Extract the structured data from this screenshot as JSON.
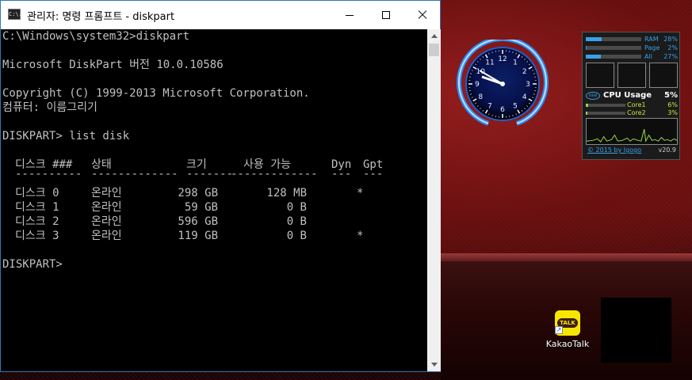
{
  "window": {
    "title": "관리자: 명령 프롬프트 - diskpart",
    "icon_text": "C:\\."
  },
  "console": {
    "lines": [
      "C:\\Windows\\system32>diskpart",
      "Microsoft DiskPart 버전 10.0.10586",
      "Copyright (C) 1999-2013 Microsoft Corporation.",
      "컴퓨터: 이름그리기",
      "DISKPART> list disk",
      "DISKPART>"
    ],
    "table": {
      "headers": [
        "디스크 ###",
        "상태",
        "크기",
        "사용 가능",
        "Dyn",
        "Gpt"
      ],
      "separators": [
        "----------",
        "-------------",
        "-------",
        "-------------",
        "---",
        "---"
      ],
      "rows": [
        {
          "disk": "디스크 0",
          "status": "온라인",
          "size": "298 GB",
          "free": "128 MB",
          "dyn": "",
          "gpt": "*"
        },
        {
          "disk": "디스크 1",
          "status": "온라인",
          "size": "59 GB",
          "free": "0 B",
          "dyn": "",
          "gpt": ""
        },
        {
          "disk": "디스크 2",
          "status": "온라인",
          "size": "596 GB",
          "free": "0 B",
          "dyn": "",
          "gpt": ""
        },
        {
          "disk": "디스크 3",
          "status": "온라인",
          "size": "119 GB",
          "free": "0 B",
          "dyn": "",
          "gpt": "*"
        }
      ]
    }
  },
  "meter": {
    "rows": [
      {
        "label": "RAM",
        "value": "28%",
        "fill": 0.28
      },
      {
        "label": "Page",
        "value": "2%",
        "fill": 0.02
      },
      {
        "label": "All",
        "value": "27%",
        "fill": 0.27
      }
    ],
    "cpu_title": "CPU Usage",
    "cpu_value": "5%",
    "intel_text": "intel",
    "cores": [
      {
        "label": "Core1",
        "value": "6%",
        "fill": 0.06
      },
      {
        "label": "Core2",
        "value": "3%",
        "fill": 0.03
      }
    ],
    "link": "© 2015 by Igogo",
    "version": "v20.9"
  },
  "clock": {
    "numerals": [
      "12",
      "1",
      "2",
      "3",
      "4",
      "5",
      "6",
      "7",
      "8",
      "9",
      "10",
      "11"
    ]
  },
  "desktop": {
    "kakao_label": "KakaoTalk",
    "kakao_icon_text": "TALK",
    "shortcut_arrow": "↗"
  },
  "colors": {
    "accent": "#3aa0e8",
    "console_fg": "#c0c0c0",
    "kakao": "#f7e600"
  }
}
